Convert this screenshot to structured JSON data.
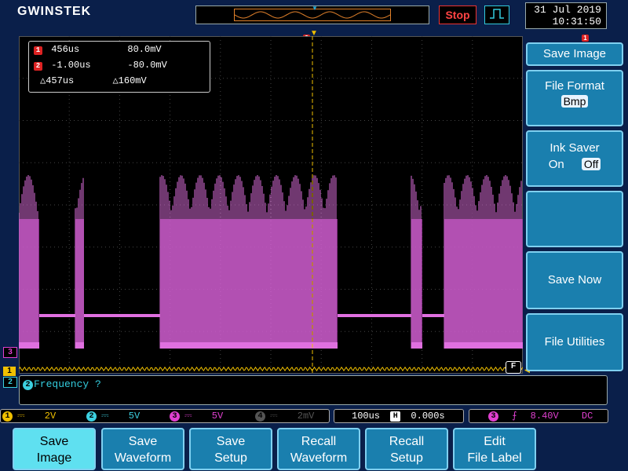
{
  "brand": "GWINSTEK",
  "run_state": "Stop",
  "datetime": {
    "date": "31 Jul 2019",
    "time": "10:31:50"
  },
  "cursor_readout": {
    "row1": {
      "channel": "1",
      "time": "456us",
      "volt": "80.0mV"
    },
    "row2": {
      "channel": "2",
      "time": "-1.00us",
      "volt": "-80.0mV"
    },
    "delta": {
      "time": "457us",
      "volt": "160mV",
      "symbol": "△"
    }
  },
  "side_menu": {
    "title": "Save Image",
    "file_format": {
      "label": "File Format",
      "value": "Bmp"
    },
    "ink_saver": {
      "label": "Ink Saver",
      "on": "On",
      "off": "Off",
      "selected": "Off"
    },
    "save_now": "Save Now",
    "file_utilities": "File Utilities"
  },
  "markers": {
    "ch1": "1",
    "ch2": "2",
    "ch3": "3",
    "trigger_level": "1",
    "filter": "F"
  },
  "measurement": {
    "text": "Frequency ?",
    "channel": "2"
  },
  "status_bar": {
    "ch1": {
      "num": "1",
      "coupling": "⎓",
      "scale": "2V",
      "color": "#f0c000"
    },
    "ch2": {
      "num": "2",
      "coupling": "⎓",
      "scale": "5V",
      "color": "#3cd0e0"
    },
    "ch3": {
      "num": "3",
      "coupling": "⎓",
      "scale": "5V",
      "color": "#e040d0"
    },
    "ch4": {
      "num": "4",
      "coupling": "⎓",
      "scale": "2mV",
      "color": "#555555"
    },
    "timebase": "100us",
    "h_icon": "H",
    "h_position": "0.000s",
    "trigger": {
      "source": "3",
      "slope": "⨍",
      "level": "8.40V",
      "coupling": "DC"
    }
  },
  "softkeys": [
    {
      "line1": "Save",
      "line2": "Image",
      "active": true
    },
    {
      "line1": "Save",
      "line2": "Waveform",
      "active": false
    },
    {
      "line1": "Save",
      "line2": "Setup",
      "active": false
    },
    {
      "line1": "Recall",
      "line2": "Waveform",
      "active": false
    },
    {
      "line1": "Recall",
      "line2": "Setup",
      "active": false
    },
    {
      "line1": "Edit",
      "line2": "File Label",
      "active": false
    }
  ],
  "colors": {
    "ch1": "#f0c000",
    "ch2": "#3cd0e0",
    "ch3": "#e060d0",
    "softkey": "#1a7fae",
    "softkey_active": "#5fe0f0",
    "stop": "#ff4444"
  }
}
